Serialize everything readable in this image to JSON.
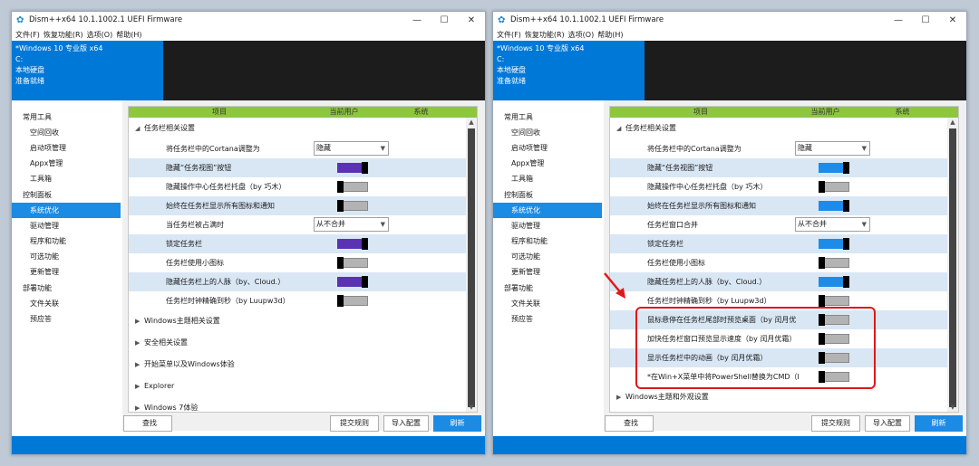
{
  "window_title": "Dism++x64 10.1.1002.1 UEFI Firmware",
  "menu": [
    "文件(F)",
    "恢复功能(R)",
    "选项(O)",
    "帮助(H)"
  ],
  "header": {
    "os": "*Windows 10 专业版 x64",
    "drive": "C:",
    "disk": "本地硬盘",
    "status": "准备就绪"
  },
  "sidebar": [
    {
      "label": "常用工具",
      "cat": true
    },
    {
      "label": "空间回收"
    },
    {
      "label": "启动项管理"
    },
    {
      "label": "Appx管理"
    },
    {
      "label": "工具箱"
    },
    {
      "label": "控制面板",
      "cat": true
    },
    {
      "label": "系统优化",
      "selected": true
    },
    {
      "label": "驱动管理"
    },
    {
      "label": "程序和功能"
    },
    {
      "label": "可选功能"
    },
    {
      "label": "更新管理"
    },
    {
      "label": "部署功能",
      "cat": true
    },
    {
      "label": "文件关联"
    },
    {
      "label": "预应答"
    }
  ],
  "columns": {
    "item": "项目",
    "current_user": "当前用户",
    "system": "系统"
  },
  "buttons": {
    "search": "查找",
    "submit": "提交规则",
    "import": "导入配置",
    "refresh": "刷新"
  },
  "windows": [
    {
      "rows": [
        {
          "type": "group",
          "arrow": "◢",
          "label": "任务栏相关设置"
        },
        {
          "type": "dropdown",
          "label": "将任务栏中的Cortana调整为",
          "value": "隐藏"
        },
        {
          "type": "toggle",
          "label": "隐藏“任务视图”按钮",
          "on": true,
          "alt": true
        },
        {
          "type": "toggle",
          "label": "隐藏操作中心任务栏托盘（by 巧木）",
          "on": false
        },
        {
          "type": "toggle",
          "label": "始终在任务栏显示所有图标和通知",
          "on": false,
          "alt": true
        },
        {
          "type": "dropdown",
          "label": "当任务栏被占满时",
          "value": "从不合并"
        },
        {
          "type": "toggle",
          "label": "锁定任务栏",
          "on": true,
          "alt": true
        },
        {
          "type": "toggle",
          "label": "任务栏使用小图标",
          "on": false
        },
        {
          "type": "toggle",
          "label": "隐藏任务栏上的人脉（by、Cloud.）",
          "on": true,
          "alt": true
        },
        {
          "type": "toggle",
          "label": "任务栏时钟精确到秒（by Luupw3d）",
          "on": false
        },
        {
          "type": "group",
          "arrow": "▶",
          "label": "Windows主题相关设置"
        },
        {
          "type": "group",
          "arrow": "▶",
          "label": "安全相关设置"
        },
        {
          "type": "group",
          "arrow": "▶",
          "label": "开始菜单以及Windows体验"
        },
        {
          "type": "group",
          "arrow": "▶",
          "label": "Explorer"
        },
        {
          "type": "group",
          "arrow": "▶",
          "label": "Windows 7体验"
        }
      ]
    },
    {
      "rows": [
        {
          "type": "group",
          "arrow": "◢",
          "label": "任务栏相关设置"
        },
        {
          "type": "dropdown",
          "label": "将任务栏中的Cortana调整为",
          "value": "隐藏"
        },
        {
          "type": "toggle",
          "label": "隐藏“任务视图”按钮",
          "on": true,
          "alt": true
        },
        {
          "type": "toggle",
          "label": "隐藏操作中心任务栏托盘（by 巧木）",
          "on": false
        },
        {
          "type": "toggle",
          "label": "始终在任务栏显示所有图标和通知",
          "on": true,
          "alt": true
        },
        {
          "type": "dropdown",
          "label": "任务栏窗口合并",
          "value": "从不合并"
        },
        {
          "type": "toggle",
          "label": "锁定任务栏",
          "on": true,
          "alt": true
        },
        {
          "type": "toggle",
          "label": "任务栏使用小图标",
          "on": false
        },
        {
          "type": "toggle",
          "label": "隐藏任务栏上的人脉（by、Cloud.）",
          "on": true,
          "alt": true
        },
        {
          "type": "toggle",
          "label": "任务栏时钟精确到秒（by Luupw3d）",
          "on": false
        },
        {
          "type": "toggle",
          "label": "鼠标悬停在任务栏尾部时预览桌面（by 闰月优",
          "on": false,
          "alt": true
        },
        {
          "type": "toggle",
          "label": "加快任务栏窗口预览显示速度（by 闰月优霜）",
          "on": false
        },
        {
          "type": "toggle",
          "label": "显示任务栏中的动画（by 闰月优霜）",
          "on": false,
          "alt": true
        },
        {
          "type": "toggle",
          "label": "*在Win+X菜单中将PowerShell替换为CMD（I",
          "on": false
        },
        {
          "type": "group",
          "arrow": "▶",
          "label": "Windows主题和外观设置"
        }
      ]
    }
  ],
  "colors": {
    "accent": "#0078d7",
    "header_green": "#8dc63f",
    "toggle_on_w1": "#5a32b3",
    "toggle_on_w2": "#1c8ce8",
    "highlight": "#e01818"
  }
}
